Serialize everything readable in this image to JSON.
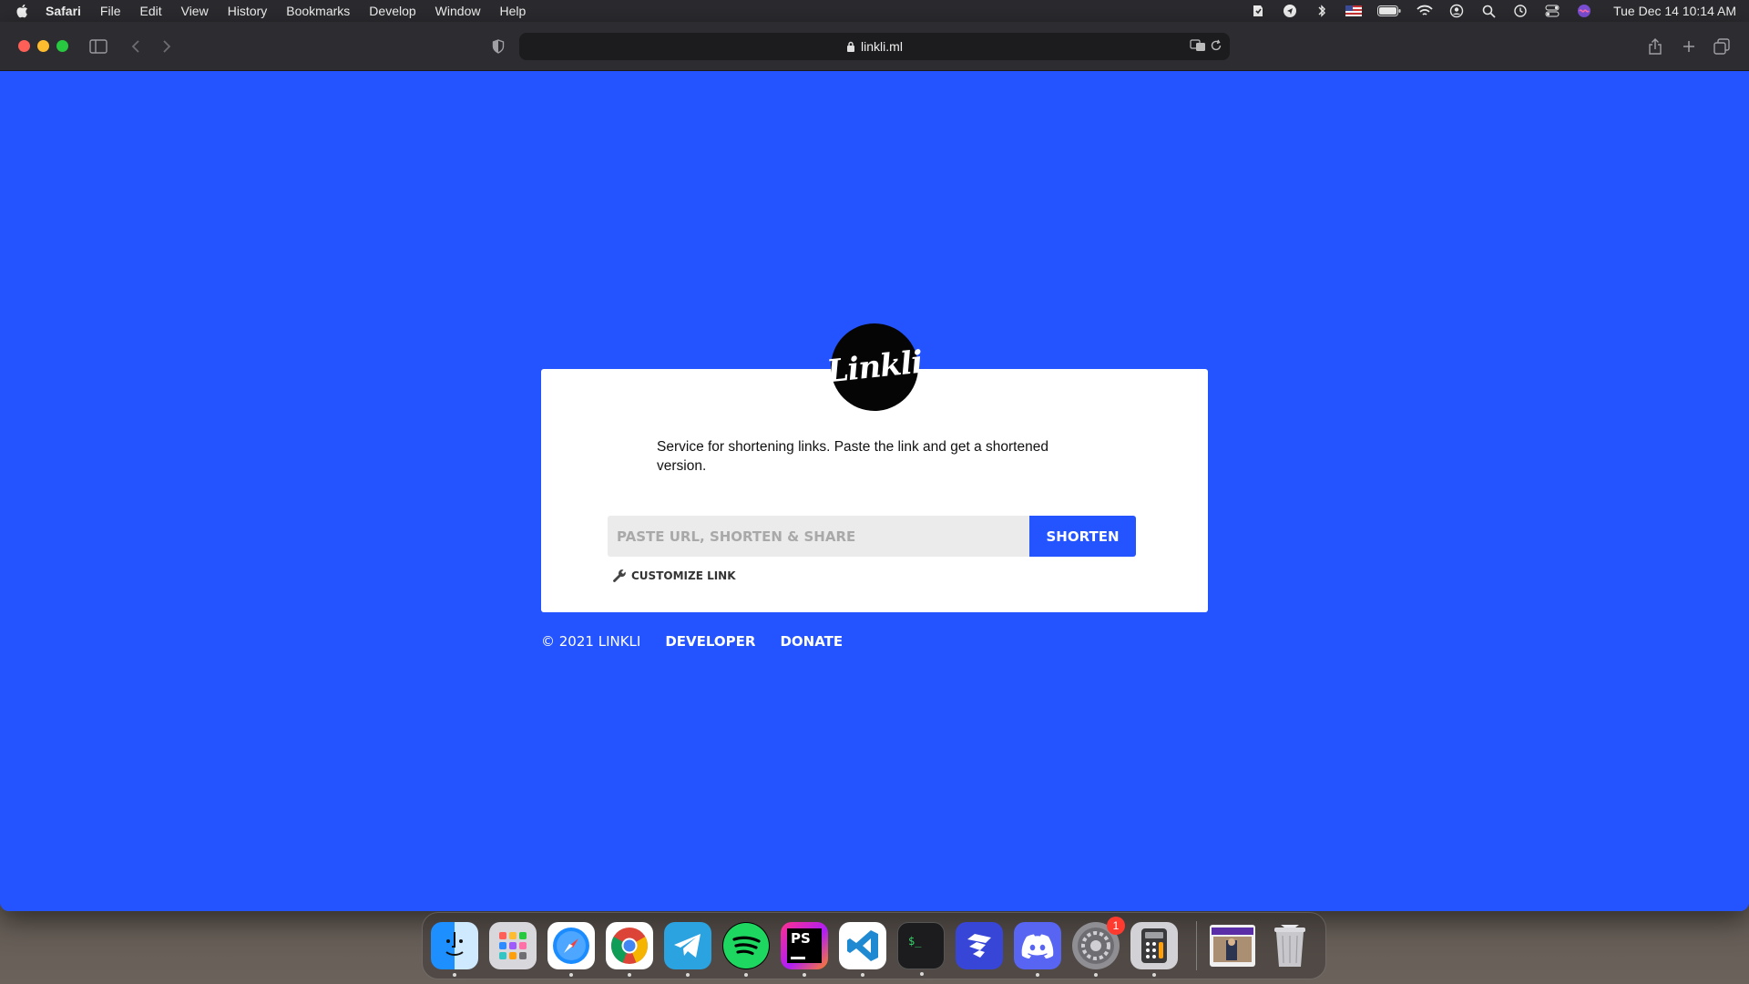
{
  "menubar": {
    "app_name": "Safari",
    "items": [
      "File",
      "Edit",
      "View",
      "History",
      "Bookmarks",
      "Develop",
      "Window",
      "Help"
    ],
    "clock": "Tue Dec 14  10:14 AM"
  },
  "browser": {
    "url": "linkli.ml"
  },
  "page": {
    "logo_text": "Linkli",
    "description": "Service for shortening links. Paste the link and get a shortened version.",
    "input_placeholder": "PASTE URL, SHORTEN & SHARE",
    "shorten_label": "SHORTEN",
    "customize_label": "CUSTOMIZE LINK",
    "footer": {
      "copyright": "© 2021 LINKLI",
      "developer": "DEVELOPER",
      "donate": "DONATE"
    },
    "colors": {
      "background": "#2454ff",
      "button": "#2454ff",
      "card": "#ffffff"
    }
  },
  "dock": {
    "apps": [
      "finder-icon",
      "launchpad-icon",
      "safari-icon",
      "chrome-icon",
      "telegram-icon",
      "spotify-icon",
      "phpstorm-icon",
      "vscode-icon",
      "terminal-icon",
      "linear-icon",
      "discord-icon",
      "system-preferences-icon",
      "calculator-icon",
      "screenshot-thumbnail-icon",
      "trash-icon"
    ],
    "system_preferences_badge": "1"
  }
}
